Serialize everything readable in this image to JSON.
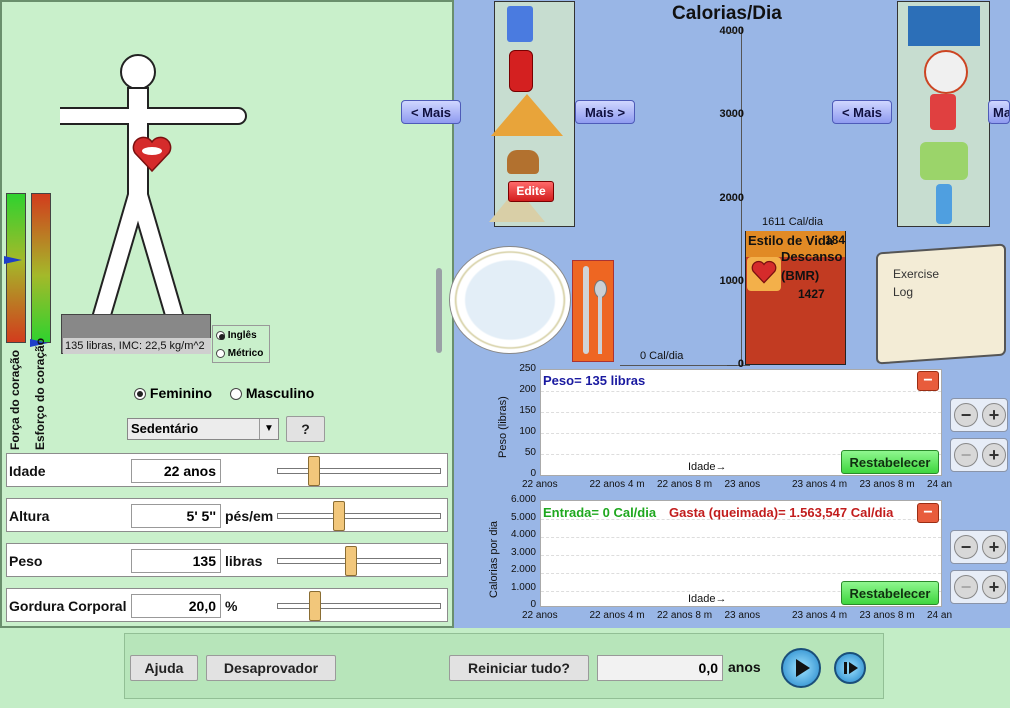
{
  "left": {
    "scale_text": "135 libras, IMC: 22,5 kg/m^2",
    "units_options": [
      "Inglês",
      "Métrico"
    ],
    "heart_strength_label": "Força do coração",
    "heart_effort_label": "Esforço do coração",
    "gender_options": [
      "Feminino",
      "Masculino"
    ],
    "activity_level": "Sedentário",
    "help_q": "?",
    "rows": [
      {
        "label": "Idade",
        "value": "22 anos",
        "unit": "",
        "slider": 0.25
      },
      {
        "label": "Altura",
        "value": "5' 5''",
        "unit": "pés/em",
        "slider": 0.43
      },
      {
        "label": "Peso",
        "value": "135",
        "unit": "libras",
        "slider": 0.49
      },
      {
        "label": "Gordura Corporal",
        "value": "20,0",
        "unit": "%",
        "slider": 0.25
      }
    ]
  },
  "food": {
    "prev_label": "< Mais",
    "next_label": "Mais >",
    "edit_label": "Edite",
    "plate_label": "0 Cal/dia"
  },
  "calories": {
    "title": "Calorias/Dia",
    "ticks": [
      "4000",
      "3000",
      "2000",
      "1000",
      "0"
    ],
    "bar_top_label": "1611 Cal/dia",
    "lifestyle_label": "Estilo de Vida",
    "lifestyle_value": "184",
    "rest_label": "Descanso",
    "bmr_label": "(BMR)",
    "bmr_value": "1427",
    "bar_value": 1611,
    "max": 4000
  },
  "activity": {
    "prev_label": "< Mais",
    "next_label": "Ma",
    "log_title": "Exercise Log"
  },
  "weight_graph": {
    "ylabel": "Peso (libras)",
    "legend": "Peso= 135 libras",
    "yticks": [
      "250",
      "200",
      "150",
      "100",
      "50",
      "0"
    ],
    "xticks": [
      "22 anos",
      "22 anos 4 m",
      "22 anos 8 m",
      "23 anos",
      "23 anos 4 m",
      "23 anos 8 m",
      "24 an"
    ],
    "xaxis_label": "Idade",
    "reset_label": "Restabelecer"
  },
  "calorie_graph": {
    "ylabel": "Calorias por dia",
    "legend_in": "Entrada= 0 Cal/dia",
    "legend_out": "Gasta (queimada)= 1.563,547 Cal/dia",
    "yticks": [
      "6.000",
      "5.000",
      "4.000",
      "3.000",
      "2.000",
      "1.000",
      "0"
    ],
    "xticks": [
      "22 anos",
      "22 anos 4 m",
      "22 anos 8 m",
      "23 anos",
      "23 anos 4 m",
      "23 anos 8 m",
      "24 an"
    ],
    "xaxis_label": "Idade",
    "reset_label": "Restabelecer"
  },
  "bottom": {
    "help_label": "Ajuda",
    "disapprove_label": "Desaprovador",
    "reset_all_label": "Reiniciar tudo?",
    "time_value": "0,0",
    "time_unit": "anos"
  },
  "colors": {
    "accent_blue": "#99b6e6",
    "panel_green": "#c9f0cb",
    "bar_red": "#c23b22"
  }
}
